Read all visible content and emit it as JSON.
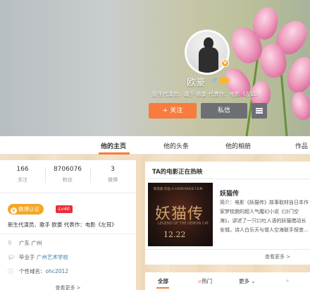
{
  "profile": {
    "name": "欧豪",
    "gender_icon": "male-icon",
    "bio": "新生代演员、歌手 欧豪 代表作：电影《左耳》",
    "follow_label": "+ 关注",
    "message_label": "私信"
  },
  "tabs": [
    "他的主页",
    "他的头条",
    "他的相册",
    "作品"
  ],
  "stats": [
    {
      "value": "166",
      "label": "关注"
    },
    {
      "value": "8706076",
      "label": "粉丝"
    },
    {
      "value": "3",
      "label": "微博"
    }
  ],
  "left": {
    "verify_badge": "微博认证",
    "level_badge": "Lv40",
    "description": "新生代演员、歌手 欧豪 代表作：电影《左耳》",
    "location": "广东 广州",
    "school_prefix": "毕业于",
    "school": "广州艺术学校",
    "domain_prefix": "个性域名：",
    "domain": "ohc2012",
    "more": "查看更多 >"
  },
  "movie_card": {
    "title": "TA的电影正在热映",
    "movie_name": "妖猫传",
    "description": "简介：电影《妖猫传》故事取材自日本作家梦枕貌的超人气魔幻小说《沙门空海》，讲述了一只口吐人语的妖猫搅动长安城，诗人白乐天与僧人空海联手探查…",
    "poster_title": "妖猫传",
    "poster_top": "陈凯歌 作品 A CHEN KAIGE FILM",
    "poster_sub": "LEGEND OF THE DEMON CAT",
    "poster_date": "12.22",
    "see_more": "查看更多 >"
  },
  "feed_tabs": {
    "all": "全部",
    "hot": "热门",
    "more": "更多"
  },
  "colors": {
    "accent": "#f77c3d",
    "verify": "#f5a623",
    "level": "#e6303c",
    "link": "#3e7aa6"
  }
}
